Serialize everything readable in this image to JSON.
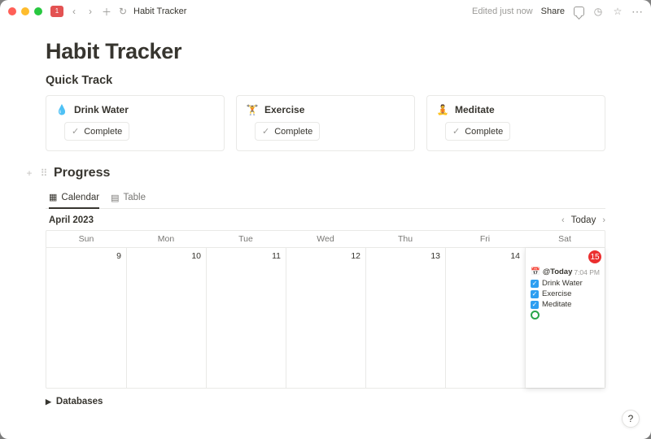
{
  "window": {
    "sidebar_badge": "1",
    "breadcrumb": "Habit Tracker",
    "edited": "Edited just now",
    "share": "Share"
  },
  "page": {
    "title": "Habit Tracker",
    "quick_track_heading": "Quick Track",
    "progress_heading": "Progress",
    "databases_heading": "Databases"
  },
  "cards": [
    {
      "icon": "water-drop-icon",
      "glyph": "💧",
      "title": "Drink Water",
      "button": "Complete"
    },
    {
      "icon": "dumbbell-icon",
      "glyph": "🏋",
      "title": "Exercise",
      "button": "Complete"
    },
    {
      "icon": "lotus-icon",
      "glyph": "🧘",
      "title": "Meditate",
      "button": "Complete"
    }
  ],
  "tabs": [
    {
      "icon": "calendar-icon",
      "glyph": "▦",
      "label": "Calendar",
      "active": true
    },
    {
      "icon": "table-icon",
      "glyph": "▤",
      "label": "Table",
      "active": false
    }
  ],
  "calendar": {
    "month_label": "April 2023",
    "today_label": "Today",
    "dow": [
      "Sun",
      "Mon",
      "Tue",
      "Wed",
      "Thu",
      "Fri",
      "Sat"
    ],
    "days": [
      9,
      10,
      11,
      12,
      13,
      14,
      15
    ],
    "today_index": 6,
    "entry": {
      "title_prefix": "📅",
      "title": "@Today",
      "time": "7:04 PM",
      "habits": [
        "Drink Water",
        "Exercise",
        "Meditate"
      ]
    }
  },
  "help": "?"
}
